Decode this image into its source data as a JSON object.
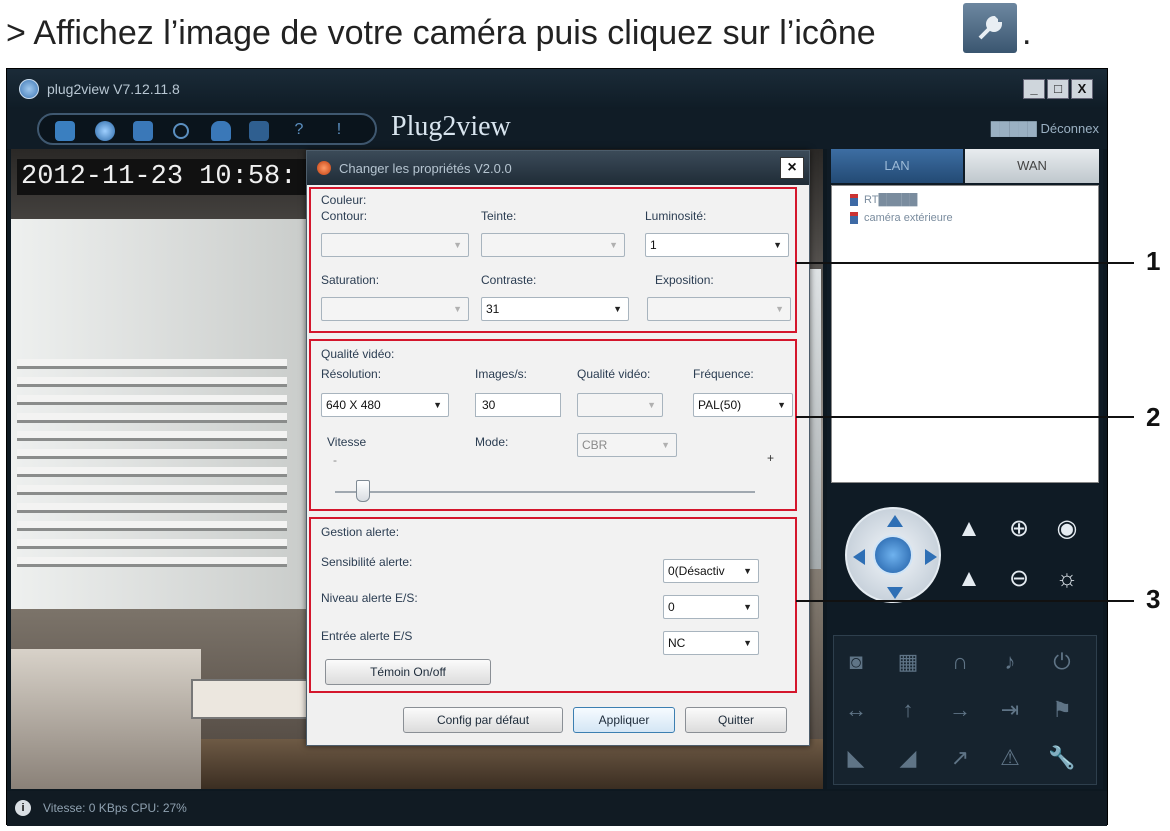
{
  "instruction": {
    "text": "> Affichez l’image de votre caméra puis cliquez sur l’icône",
    "trailing": "."
  },
  "app": {
    "title": "plug2view  V7.12.11.8",
    "brand": "Plug2view",
    "user_text": "█████ Déconnex",
    "window_buttons": [
      "_",
      "□",
      "X"
    ],
    "timestamp": "2012-11-23 10:58:",
    "tabs": {
      "lan": "LAN",
      "wan": "WAN"
    },
    "devices": [
      "RT█████",
      "caméra extérieure"
    ],
    "status": "Vitesse: 0 KBps  CPU:  27%"
  },
  "dialog": {
    "title": "Changer les propriétés V2.0.0",
    "close": "×",
    "couleur": {
      "group": "Couleur:",
      "contour_label": "Contour:",
      "contour_value": "",
      "teinte_label": "Teinte:",
      "teinte_value": "",
      "luminosite_label": "Luminosité:",
      "luminosite_value": "1",
      "saturation_label": "Saturation:",
      "saturation_value": "",
      "contraste_label": "Contraste:",
      "contraste_value": "31",
      "exposition_label": "Exposition:",
      "exposition_value": ""
    },
    "video": {
      "group": "Qualité vidéo:",
      "resolution_label": "Résolution:",
      "resolution_value": "640 X 480",
      "images_label": "Images/s:",
      "images_value": "30",
      "qualite_label": "Qualité vidéo:",
      "qualite_value": "",
      "frequence_label": "Fréquence:",
      "frequence_value": "PAL(50)",
      "vitesse_label": "Vitesse",
      "mode_label": "Mode:",
      "mode_value": "CBR",
      "minus": "-",
      "plus": "+",
      "speed_level": 0.05
    },
    "alerte": {
      "group": "Gestion alerte:",
      "sensibilite_label": "Sensibilité alerte:",
      "sensibilite_value": "0(Désactiv",
      "niveau_label": "Niveau alerte E/S:",
      "niveau_value": "0",
      "entree_label": "Entrée alerte E/S",
      "entree_value": "NC",
      "temoin_button": "Témoin On/off"
    },
    "buttons": {
      "default": "Config par défaut",
      "apply": "Appliquer",
      "quit": "Quitter"
    }
  },
  "callouts": [
    "1",
    "2",
    "3"
  ],
  "colors": {
    "callout_border": "#d4162c",
    "accent": "#3c7fb1"
  }
}
